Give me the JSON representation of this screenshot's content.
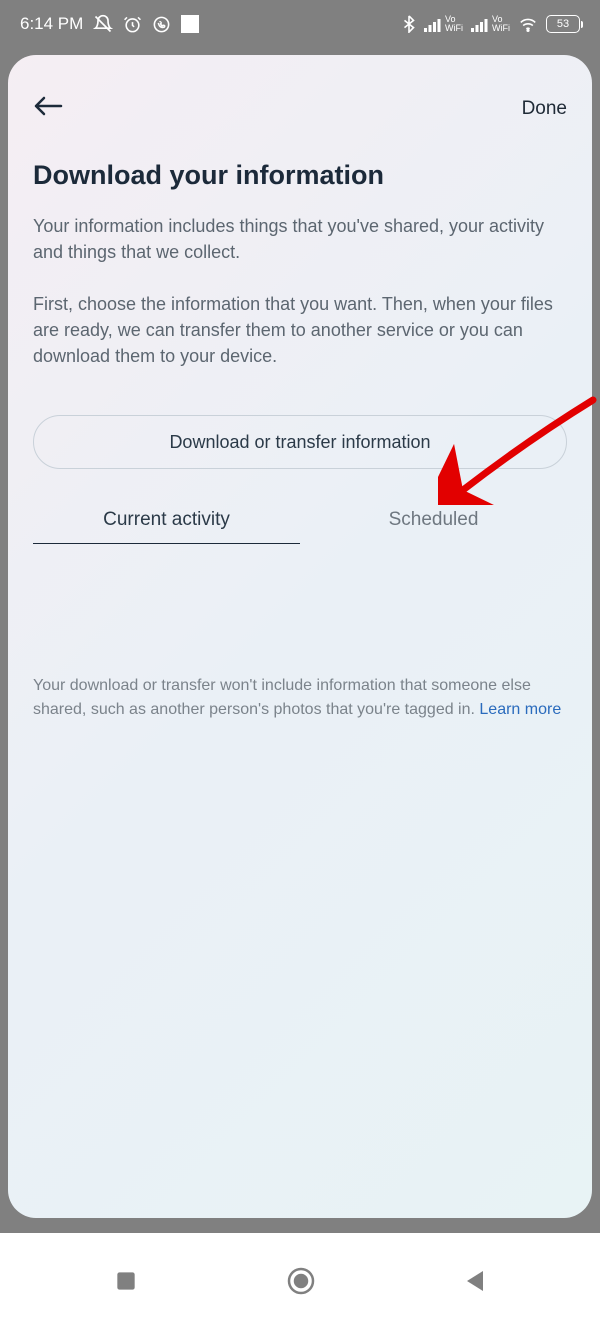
{
  "status": {
    "time": "6:14 PM",
    "battery": "53"
  },
  "header": {
    "done": "Done"
  },
  "page": {
    "title": "Download your information",
    "p1": "Your information includes things that you've shared, your activity and things that we collect.",
    "p2": "First, choose the information that you want. Then, when your files are ready, we can transfer them to another service or you can download them to your device.",
    "cta": "Download or transfer information"
  },
  "tabs": {
    "current": "Current activity",
    "scheduled": "Scheduled"
  },
  "footnote": {
    "text": "Your download or transfer won't include information that someone else shared, such as another person's photos that you're tagged in. ",
    "link": "Learn more"
  }
}
